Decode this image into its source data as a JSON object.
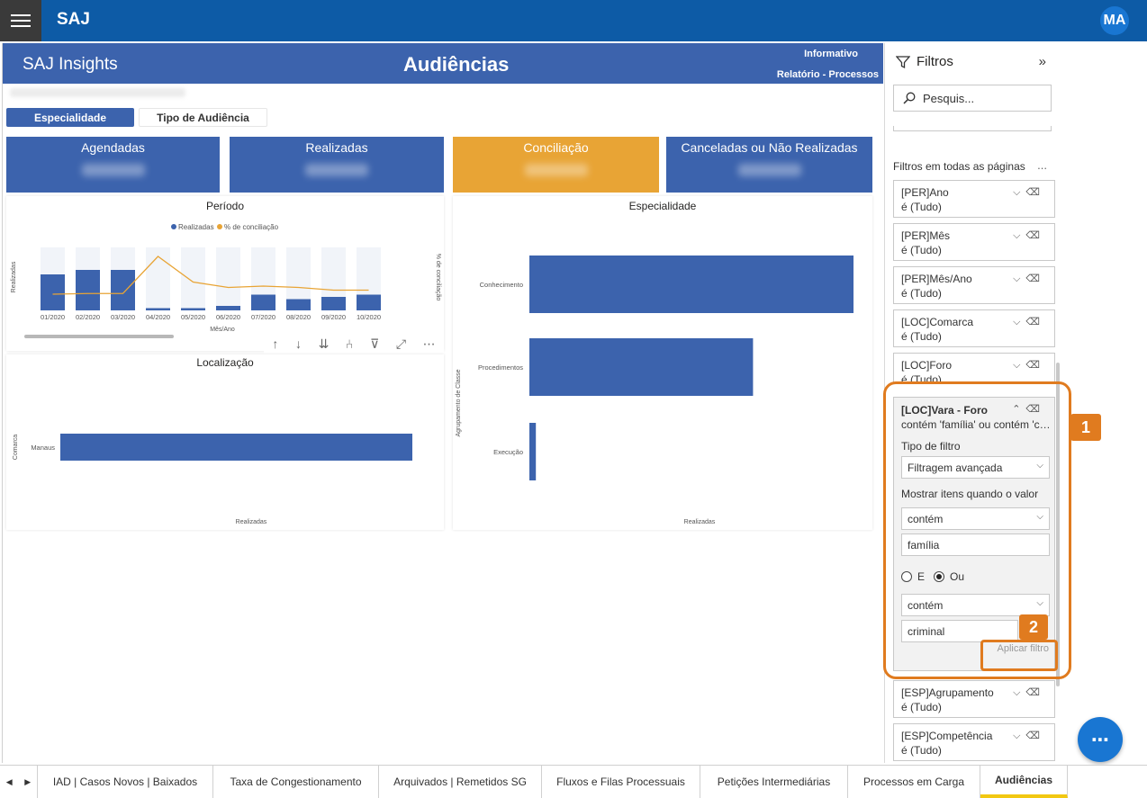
{
  "app": {
    "brand": "SAJ",
    "avatar": "MA"
  },
  "report": {
    "banner_left": "SAJ Insights",
    "title": "Audiências",
    "banner_right_top": "Informativo",
    "banner_right_bottom": "Relatório - Processos",
    "tabs": [
      {
        "label": "Especialidade",
        "active": true
      },
      {
        "label": "Tipo de Audiência",
        "active": false
      }
    ],
    "kpis": [
      "Agendadas",
      "Realizadas",
      "Conciliação",
      "Canceladas ou Não Realizadas"
    ]
  },
  "chart_data": [
    {
      "type": "bar",
      "title": "Período",
      "xlabel": "Mês/Ano",
      "ylabel": "Realizadas",
      "y2label": "% de conciliação",
      "legend": [
        "Realizadas",
        "% de conciliação"
      ],
      "categories": [
        "01/2020",
        "02/2020",
        "03/2020",
        "04/2020",
        "05/2020",
        "06/2020",
        "07/2020",
        "08/2020",
        "09/2020",
        "10/2020"
      ],
      "series": [
        {
          "name": "Realizadas",
          "values": [
            16,
            18,
            18,
            1,
            1,
            2,
            7,
            5,
            6,
            7
          ]
        },
        {
          "name": "% de conciliação",
          "values": [
            24,
            25,
            25,
            80,
            42,
            34,
            36,
            34,
            30,
            30
          ]
        }
      ]
    },
    {
      "type": "bar",
      "title": "Especialidade",
      "xlabel": "Realizadas",
      "ylabel": "Agrupamento de Classe",
      "categories": [
        "Conhecimento",
        "Procedimentos",
        "Execução"
      ],
      "values": [
        100,
        69,
        2
      ]
    },
    {
      "type": "bar",
      "title": "Localização",
      "xlabel": "Realizadas",
      "ylabel": "Comarca",
      "categories": [
        "Manaus"
      ],
      "values": [
        100
      ]
    }
  ],
  "filters": {
    "title": "Filtros",
    "search_placeholder": "Pesquis...",
    "all_pages_label": "Filtros em todas as páginas",
    "more": "...",
    "cards_top": [
      {
        "name": "[PER]Ano",
        "state": "é (Tudo)"
      },
      {
        "name": "[PER]Mês",
        "state": "é (Tudo)"
      },
      {
        "name": "[PER]Mês/Ano",
        "state": "é (Tudo)"
      },
      {
        "name": "[LOC]Comarca",
        "state": "é (Tudo)"
      },
      {
        "name": "[LOC]Foro",
        "state": "é (Tudo)"
      }
    ],
    "expanded": {
      "name": "[LOC]Vara - Foro",
      "desc": "contém 'família' ou contém 'criminal'",
      "type_label": "Tipo de filtro",
      "type_value": "Filtragem avançada",
      "show_label": "Mostrar itens quando o valor",
      "op1": "contém",
      "val1": "família",
      "radio_and": "E",
      "radio_or": "Ou",
      "op2": "contém",
      "val2": "criminal",
      "apply": "Aplicar filtro"
    },
    "cards_bottom": [
      {
        "name": "[ESP]Agrupamento",
        "state": "é (Tudo)"
      },
      {
        "name": "[ESP]Competência",
        "state": "é (Tudo)"
      }
    ]
  },
  "callouts": {
    "one": "1",
    "two": "2"
  },
  "page_tabs": [
    "IAD | Casos Novos | Baixados",
    "Taxa de Congestionamento",
    "Arquivados | Remetidos SG",
    "Fluxos e Filas Processuais",
    "Petições Intermediárias",
    "Processos em Carga",
    "Audiências"
  ],
  "colors": {
    "blue": "#3c63ad",
    "orange": "#e8a435",
    "callout": "#e07b1f",
    "topbar": "#0d5ba6"
  }
}
